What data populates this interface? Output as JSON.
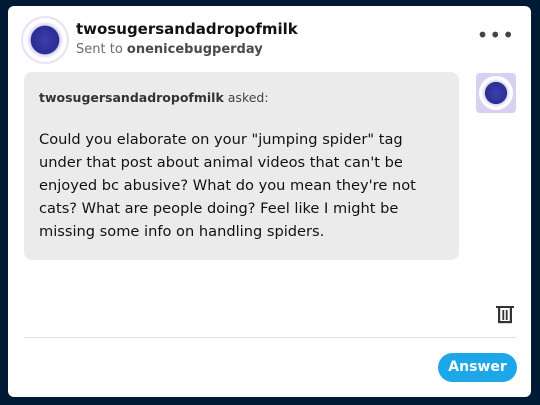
{
  "header": {
    "blog_name": "twosugersandadropofmilk",
    "sent_prefix": "Sent to",
    "recipient": "onenicebugperday",
    "more_label": "•••"
  },
  "ask": {
    "asker": "twosugersandadropofmilk",
    "asked_label": "asked:",
    "question": "Could you elaborate on your \"jumping spider\" tag under that post about animal videos that can't be enjoyed bc abusive? What do you mean they're not cats? What are people doing? Feel like I might be missing some info on handling spiders."
  },
  "icons": {
    "avatar": "avatar-icon",
    "trash": "trash-icon",
    "more": "more-options-icon"
  },
  "actions": {
    "answer_label": "Answer"
  },
  "colors": {
    "background": "#001935",
    "answer_button": "#1ea7e8",
    "bubble": "#ebebeb"
  }
}
